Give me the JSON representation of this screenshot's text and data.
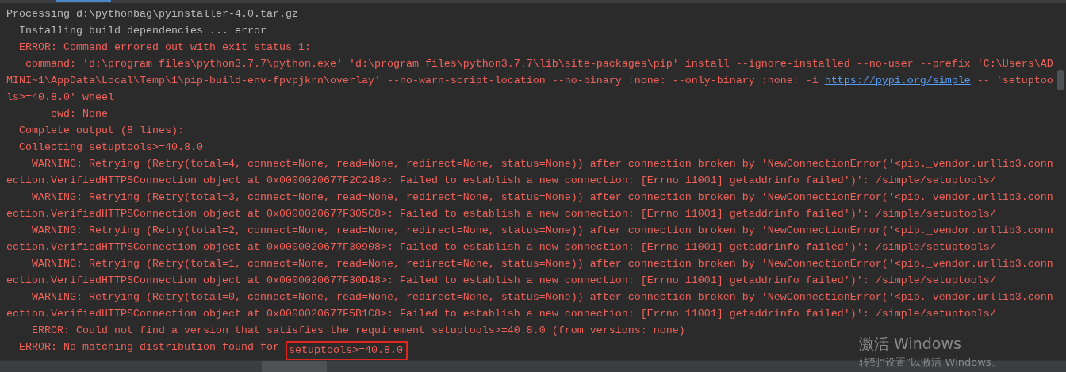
{
  "lines": [
    {
      "kind": "plain",
      "segments": [
        {
          "kind": "text",
          "text": "Processing d:\\pythonbag\\pyinstaller-4.0.tar.gz"
        }
      ]
    },
    {
      "kind": "plain",
      "segments": [
        {
          "kind": "text",
          "text": "  Installing build dependencies ... error"
        }
      ]
    },
    {
      "kind": "error",
      "segments": [
        {
          "kind": "text",
          "text": "  ERROR: Command errored out with exit status 1:"
        }
      ]
    },
    {
      "kind": "error",
      "segments": [
        {
          "kind": "text",
          "text": "   command: 'd:\\program files\\python3.7.7\\python.exe' 'd:\\program files\\python3.7.7\\lib\\site-packages\\pip' install --ignore-installed --no-user --prefix 'C:\\Users\\AD"
        }
      ]
    },
    {
      "kind": "error",
      "segments": [
        {
          "kind": "text",
          "text": "MINI~1\\AppData\\Local\\Temp\\1\\pip-build-env-fpvpjkrn\\overlay' --no-warn-script-location --no-binary :none: --only-binary :none: -i "
        },
        {
          "kind": "link",
          "text": "https://pypi.org/simple"
        },
        {
          "kind": "text",
          "text": " -- 'setuptoo"
        }
      ]
    },
    {
      "kind": "error",
      "segments": [
        {
          "kind": "text",
          "text": "ls>=40.8.0' wheel"
        }
      ]
    },
    {
      "kind": "error",
      "segments": [
        {
          "kind": "text",
          "text": "       cwd: None"
        }
      ]
    },
    {
      "kind": "error",
      "segments": [
        {
          "kind": "text",
          "text": "  Complete output (8 lines):"
        }
      ]
    },
    {
      "kind": "error",
      "segments": [
        {
          "kind": "text",
          "text": "  Collecting setuptools>=40.8.0"
        }
      ]
    },
    {
      "kind": "error",
      "segments": [
        {
          "kind": "text",
          "text": "    WARNING: Retrying (Retry(total=4, connect=None, read=None, redirect=None, status=None)) after connection broken by 'NewConnectionError('<pip._vendor.urllib3.conn"
        }
      ]
    },
    {
      "kind": "error",
      "segments": [
        {
          "kind": "text",
          "text": "ection.VerifiedHTTPSConnection object at 0x0000020677F2C248>: Failed to establish a new connection: [Errno 11001] getaddrinfo failed')': /simple/setuptools/"
        }
      ]
    },
    {
      "kind": "error",
      "segments": [
        {
          "kind": "text",
          "text": "    WARNING: Retrying (Retry(total=3, connect=None, read=None, redirect=None, status=None)) after connection broken by 'NewConnectionError('<pip._vendor.urllib3.conn"
        }
      ]
    },
    {
      "kind": "error",
      "segments": [
        {
          "kind": "text",
          "text": "ection.VerifiedHTTPSConnection object at 0x0000020677F305C8>: Failed to establish a new connection: [Errno 11001] getaddrinfo failed')': /simple/setuptools/"
        }
      ]
    },
    {
      "kind": "error",
      "segments": [
        {
          "kind": "text",
          "text": "    WARNING: Retrying (Retry(total=2, connect=None, read=None, redirect=None, status=None)) after connection broken by 'NewConnectionError('<pip._vendor.urllib3.conn"
        }
      ]
    },
    {
      "kind": "error",
      "segments": [
        {
          "kind": "text",
          "text": "ection.VerifiedHTTPSConnection object at 0x0000020677F30908>: Failed to establish a new connection: [Errno 11001] getaddrinfo failed')': /simple/setuptools/"
        }
      ]
    },
    {
      "kind": "error",
      "segments": [
        {
          "kind": "text",
          "text": "    WARNING: Retrying (Retry(total=1, connect=None, read=None, redirect=None, status=None)) after connection broken by 'NewConnectionError('<pip._vendor.urllib3.conn"
        }
      ]
    },
    {
      "kind": "error",
      "segments": [
        {
          "kind": "text",
          "text": "ection.VerifiedHTTPSConnection object at 0x0000020677F30D48>: Failed to establish a new connection: [Errno 11001] getaddrinfo failed')': /simple/setuptools/"
        }
      ]
    },
    {
      "kind": "error",
      "segments": [
        {
          "kind": "text",
          "text": "    WARNING: Retrying (Retry(total=0, connect=None, read=None, redirect=None, status=None)) after connection broken by 'NewConnectionError('<pip._vendor.urllib3.conn"
        }
      ]
    },
    {
      "kind": "error",
      "segments": [
        {
          "kind": "text",
          "text": "ection.VerifiedHTTPSConnection object at 0x0000020677F5B1C8>: Failed to establish a new connection: [Errno 11001] getaddrinfo failed')': /simple/setuptools/"
        }
      ]
    },
    {
      "kind": "error",
      "segments": [
        {
          "kind": "text",
          "text": "    ERROR: Could not find a version that satisfies the requirement setuptools>=40.8.0 (from versions: none)"
        }
      ]
    },
    {
      "kind": "error",
      "segments": [
        {
          "kind": "text",
          "text": "  ERROR: No matching distribution found for "
        },
        {
          "kind": "highlight",
          "text": "setuptools>=40.8.0"
        }
      ]
    }
  ],
  "activation_notice": {
    "title": "激活 Windows",
    "subtitle": "转到“设置”以激活 Windows。"
  }
}
